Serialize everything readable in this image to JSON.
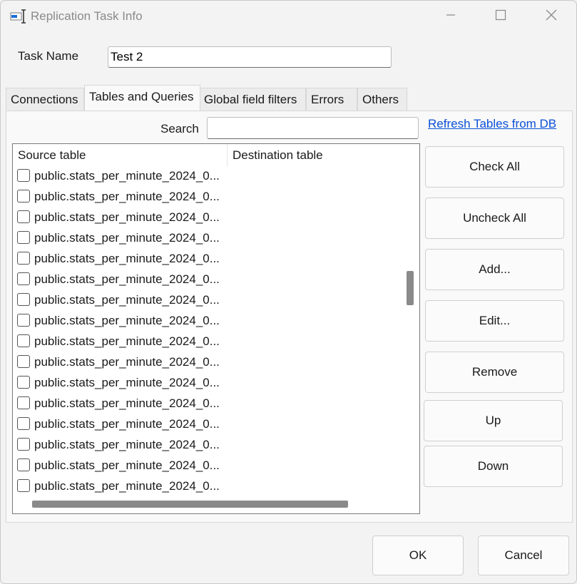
{
  "window": {
    "title": "Replication Task Info"
  },
  "task": {
    "name_label": "Task Name",
    "name_value": "Test 2"
  },
  "tabs": [
    {
      "label": "Connections"
    },
    {
      "label": "Tables and Queries",
      "active": true
    },
    {
      "label": "Global field filters"
    },
    {
      "label": "Errors"
    },
    {
      "label": "Others"
    }
  ],
  "search": {
    "label": "Search",
    "value": ""
  },
  "refresh_link": "Refresh Tables from DB",
  "table": {
    "columns": [
      "Source table",
      "Destination table"
    ],
    "rows": [
      {
        "source": "public.stats_per_minute_2024_0...",
        "destination": "",
        "checked": false
      },
      {
        "source": "public.stats_per_minute_2024_0...",
        "destination": "",
        "checked": false
      },
      {
        "source": "public.stats_per_minute_2024_0...",
        "destination": "",
        "checked": false
      },
      {
        "source": "public.stats_per_minute_2024_0...",
        "destination": "",
        "checked": false
      },
      {
        "source": "public.stats_per_minute_2024_0...",
        "destination": "",
        "checked": false
      },
      {
        "source": "public.stats_per_minute_2024_0...",
        "destination": "",
        "checked": false
      },
      {
        "source": "public.stats_per_minute_2024_0...",
        "destination": "",
        "checked": false
      },
      {
        "source": "public.stats_per_minute_2024_0...",
        "destination": "",
        "checked": false
      },
      {
        "source": "public.stats_per_minute_2024_0...",
        "destination": "",
        "checked": false
      },
      {
        "source": "public.stats_per_minute_2024_0...",
        "destination": "",
        "checked": false
      },
      {
        "source": "public.stats_per_minute_2024_0...",
        "destination": "",
        "checked": false
      },
      {
        "source": "public.stats_per_minute_2024_0...",
        "destination": "",
        "checked": false
      },
      {
        "source": "public.stats_per_minute_2024_0...",
        "destination": "",
        "checked": false
      },
      {
        "source": "public.stats_per_minute_2024_0...",
        "destination": "",
        "checked": false
      },
      {
        "source": "public.stats_per_minute_2024_0...",
        "destination": "",
        "checked": false
      },
      {
        "source": "public.stats_per_minute_2024_0...",
        "destination": "",
        "checked": false
      }
    ]
  },
  "side_buttons": {
    "check_all": "Check All",
    "uncheck_all": "Uncheck All",
    "add": "Add...",
    "edit": "Edit...",
    "remove": "Remove",
    "up": "Up",
    "down": "Down"
  },
  "footer": {
    "ok": "OK",
    "cancel": "Cancel"
  },
  "icons": {
    "app": "app-window-icon",
    "minimize": "minimize-icon",
    "maximize": "maximize-icon",
    "close": "close-icon"
  },
  "colors": {
    "link": "#0a4fd6",
    "title_text": "#8a8a8a",
    "app_icon_blue": "#1e6fd9"
  }
}
